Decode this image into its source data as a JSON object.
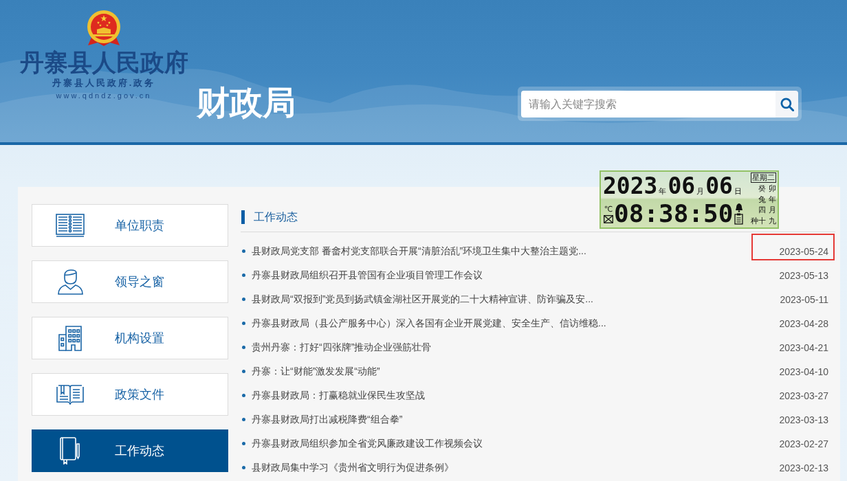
{
  "header": {
    "site_title": "丹寨县人民政府",
    "site_subtitle": "丹寨县人民政府.政务",
    "site_url": "www.qdndz.gov.cn",
    "department": "财政局",
    "search": {
      "placeholder": "请输入关键字搜索"
    }
  },
  "clock": {
    "year": "2023",
    "year_unit": "年",
    "month": "06",
    "month_unit": "月",
    "day": "06",
    "day_unit": "日",
    "weekday": "星期二",
    "lunar_lines": [
      "癸卯",
      "兔年",
      "四月"
    ],
    "solar_term": "种",
    "lunar_day": "十九",
    "temperature_unit": "℃",
    "time": "08:38:50"
  },
  "sidebar": {
    "items": [
      {
        "label": "单位职责",
        "selected": false
      },
      {
        "label": "领导之窗",
        "selected": false
      },
      {
        "label": "机构设置",
        "selected": false
      },
      {
        "label": "政策文件",
        "selected": false
      },
      {
        "label": "工作动态",
        "selected": true
      }
    ]
  },
  "news": {
    "heading": "工作动态",
    "items": [
      {
        "title": "县财政局党支部 番畲村党支部联合开展“清脏治乱”环境卫生集中大整治主题党...",
        "date": "2023-05-24",
        "highlighted": true
      },
      {
        "title": "丹寨县财政局组织召开县管国有企业项目管理工作会议",
        "date": "2023-05-13",
        "highlighted": false
      },
      {
        "title": "县财政局“双报到”党员到扬武镇金湖社区开展党的二十大精神宣讲、防诈骗及安...",
        "date": "2023-05-11",
        "highlighted": false
      },
      {
        "title": "丹寨县财政局（县公产服务中心）深入各国有企业开展党建、安全生产、信访维稳...",
        "date": "2023-04-28",
        "highlighted": false
      },
      {
        "title": "贵州丹寨：打好“四张牌”推动企业强筋壮骨",
        "date": "2023-04-21",
        "highlighted": false
      },
      {
        "title": "丹寨：让“财能”激发发展“动能”",
        "date": "2023-04-10",
        "highlighted": false
      },
      {
        "title": "丹寨县财政局：打赢稳就业保民生攻坚战",
        "date": "2023-03-27",
        "highlighted": false
      },
      {
        "title": "丹寨县财政局打出减税降费“组合拳”",
        "date": "2023-03-13",
        "highlighted": false
      },
      {
        "title": "丹寨县财政局组织参加全省党风廉政建设工作视频会议",
        "date": "2023-02-27",
        "highlighted": false
      },
      {
        "title": "县财政局集中学习《贵州省文明行为促进条例》",
        "date": "2023-02-13",
        "highlighted": false
      }
    ]
  }
}
